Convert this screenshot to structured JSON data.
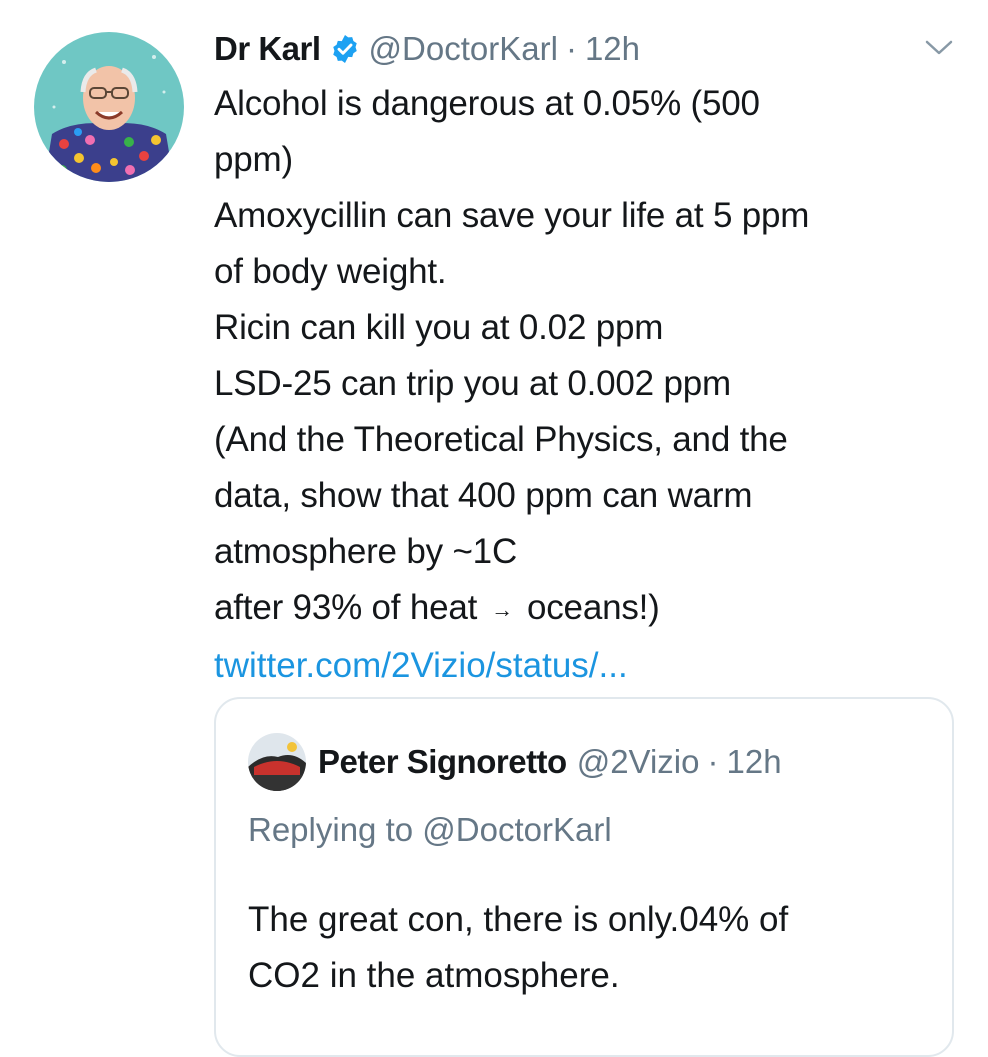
{
  "tweet": {
    "name": "Dr Karl",
    "handle": "@DoctorKarl",
    "separator": "·",
    "time": "12h",
    "lines": [
      "Alcohol is dangerous at 0.05% (500",
      "ppm)",
      "Amoxycillin can save your life at 5 ppm",
      "of body weight.",
      "Ricin can kill you at 0.02 ppm",
      "LSD-25 can trip you at 0.002 ppm",
      "(And the Theoretical Physics, and the",
      "data, show that 400 ppm can warm",
      "atmosphere by ~1C"
    ],
    "last_line_start": "after 93% of heat",
    "last_line_arrow": "→",
    "last_line_end": "oceans!)",
    "link": "twitter.com/2Vizio/status/..."
  },
  "quoted": {
    "name": "Peter Signoretto",
    "handle": "@2Vizio",
    "separator": "·",
    "time": "12h",
    "replying": "Replying to @DoctorKarl",
    "lines": [
      "The great con, there is only.04% of",
      "CO2 in the atmosphere."
    ]
  },
  "icons": {
    "verified": "verified-badge-icon",
    "menu": "chevron-down-icon"
  },
  "colors": {
    "link": "#1b95e0",
    "secondary_text": "#657786",
    "verified": "#1da1f2",
    "border": "#e1e8ed"
  }
}
